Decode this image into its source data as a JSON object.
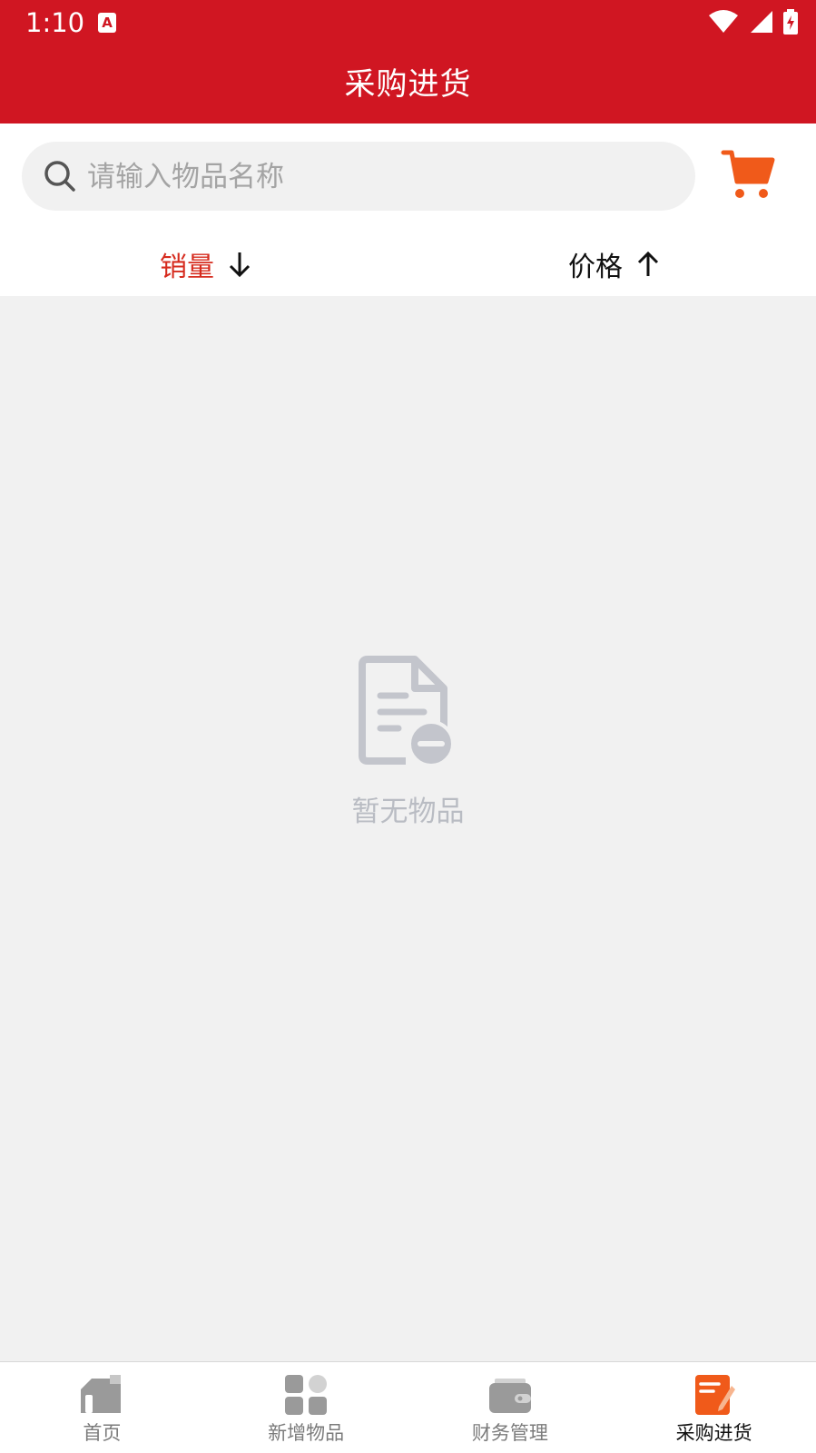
{
  "status_bar": {
    "time": "1:10",
    "notification_badge": "A"
  },
  "header": {
    "title": "采购进货"
  },
  "search": {
    "placeholder": "请输入物品名称",
    "value": ""
  },
  "sort": {
    "sales_label": "销量",
    "sales_direction": "descending",
    "price_label": "价格",
    "price_direction": "ascending",
    "active": "sales"
  },
  "empty_state": {
    "text": "暂无物品",
    "icon": "document-minus-icon"
  },
  "bottom_nav": {
    "items": [
      {
        "label": "首页",
        "icon": "home-icon",
        "active": false
      },
      {
        "label": "新增物品",
        "icon": "grid-icon",
        "active": false
      },
      {
        "label": "财务管理",
        "icon": "wallet-icon",
        "active": false
      },
      {
        "label": "采购进货",
        "icon": "clipboard-icon",
        "active": true
      }
    ]
  },
  "colors": {
    "primary": "#d01622",
    "sort_active": "#d62b1e",
    "cart": "#f05a1a",
    "background": "#f1f1f1",
    "empty": "#c3c5cc"
  }
}
